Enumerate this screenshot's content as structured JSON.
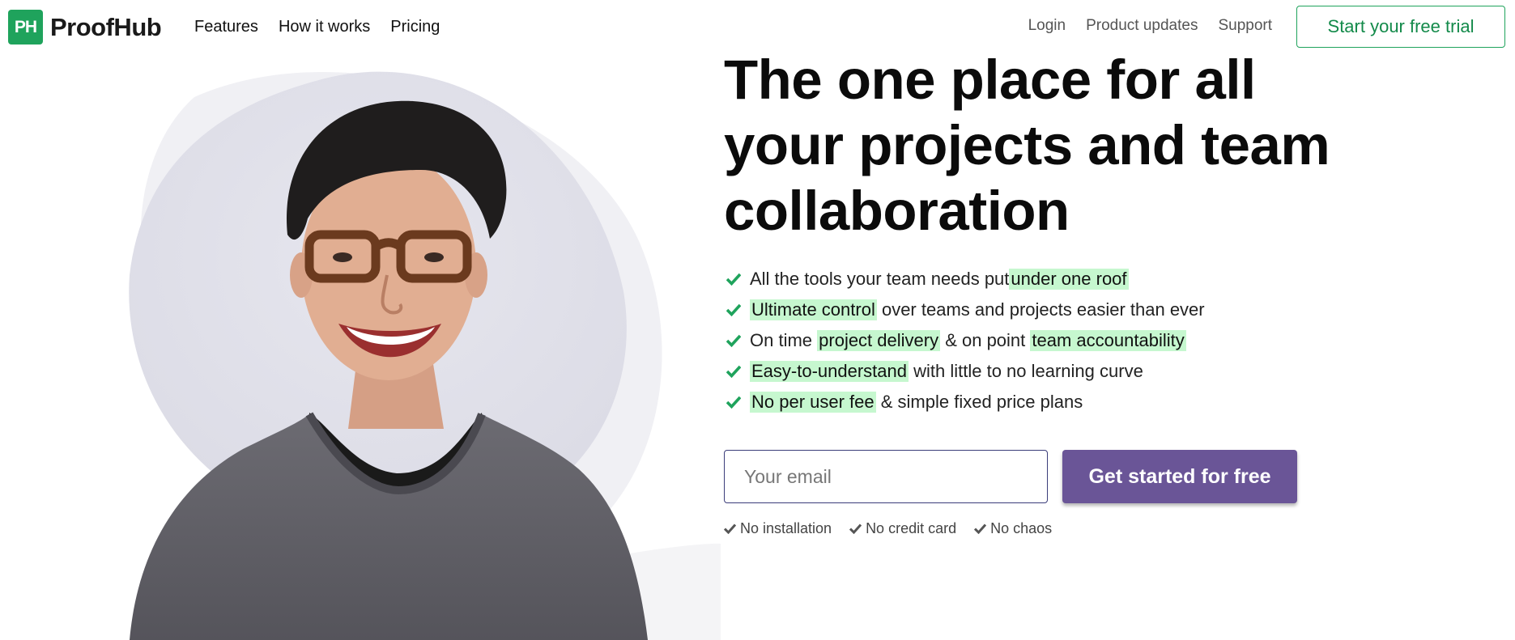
{
  "brand": {
    "logo_mark": "PH",
    "name": "ProofHub",
    "color": "#1fa35c"
  },
  "nav": {
    "left": [
      {
        "label": "Features"
      },
      {
        "label": "How it works"
      },
      {
        "label": "Pricing"
      }
    ],
    "right": [
      {
        "label": "Login"
      },
      {
        "label": "Product updates"
      },
      {
        "label": "Support"
      }
    ],
    "trial_button": "Start your free trial"
  },
  "hero": {
    "headline": "The one place for all your projects and team collaboration",
    "features": [
      {
        "before": "All the tools your team needs put ",
        "highlight": "under one roof",
        "after": ""
      },
      {
        "before": "",
        "highlight": "Ultimate control",
        "after": " over teams and projects easier than ever"
      },
      {
        "before": "On time ",
        "highlight": "project delivery",
        "middle": " & on point ",
        "highlight2": "team accountability",
        "after": ""
      },
      {
        "before": "",
        "highlight": "Easy-to-understand",
        "after": " with little to no learning curve"
      },
      {
        "before": "",
        "highlight": "No per user fee",
        "after": " & simple fixed price plans"
      }
    ],
    "email_placeholder": "Your email",
    "cta_button": "Get started for free",
    "perks": [
      "No installation",
      "No credit card",
      "No chaos"
    ],
    "icons": {
      "feature_check": "check-icon",
      "perk_check": "check-icon"
    },
    "colors": {
      "check": "#1fa35c",
      "highlight": "#c6f7cf",
      "cta": "#6a5597"
    }
  }
}
